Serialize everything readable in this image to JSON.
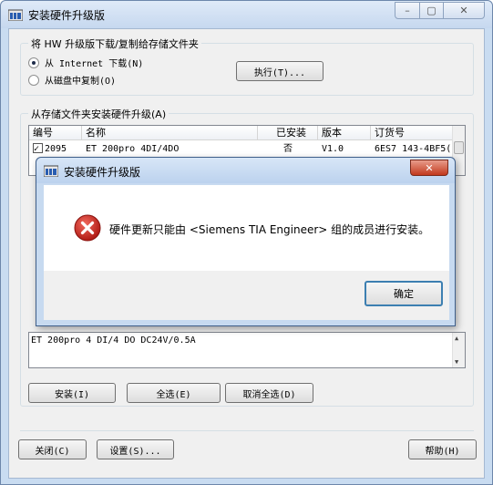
{
  "window": {
    "title": "安装硬件升级版",
    "minimize_glyph": "–",
    "maximize_glyph": "▢",
    "close_glyph": "✕"
  },
  "download_group": {
    "title": "将 HW 升级版下载/复制给存储文件夹",
    "radio_internet": "从 Internet 下载(N)",
    "radio_disk": "从磁盘中复制(O)",
    "execute_button": "执行(T)..."
  },
  "install_group": {
    "title": "从存储文件夹安装硬件升级(A)",
    "columns": [
      "编号",
      "名称",
      "已安装",
      "版本",
      "订货号"
    ],
    "rows": [
      {
        "checked": true,
        "id": "2095",
        "name": "ET 200pro 4DI/4DO",
        "installed": "否",
        "version": "V1.0",
        "order": "6ES7 143-4BF5("
      }
    ],
    "description": "ET 200pro 4 DI/4 DO DC24V/0.5A",
    "install_button": "安装(I)",
    "select_all_button": "全选(E)",
    "deselect_all_button": "取消全选(D)"
  },
  "footer": {
    "close_button": "关闭(C)",
    "settings_button": "设置(S)...",
    "help_button": "帮助(H)"
  },
  "dialog": {
    "title": "安装硬件升级版",
    "message": "硬件更新只能由 <Siemens TIA Engineer> 组的成员进行安装。",
    "ok_button": "确定",
    "close_glyph": "✕"
  },
  "colors": {
    "error_red": "#c8221d",
    "window_frame": "#c9dcf1"
  },
  "icons": {
    "app": "hardware-update-icon",
    "error": "error-x-icon"
  }
}
